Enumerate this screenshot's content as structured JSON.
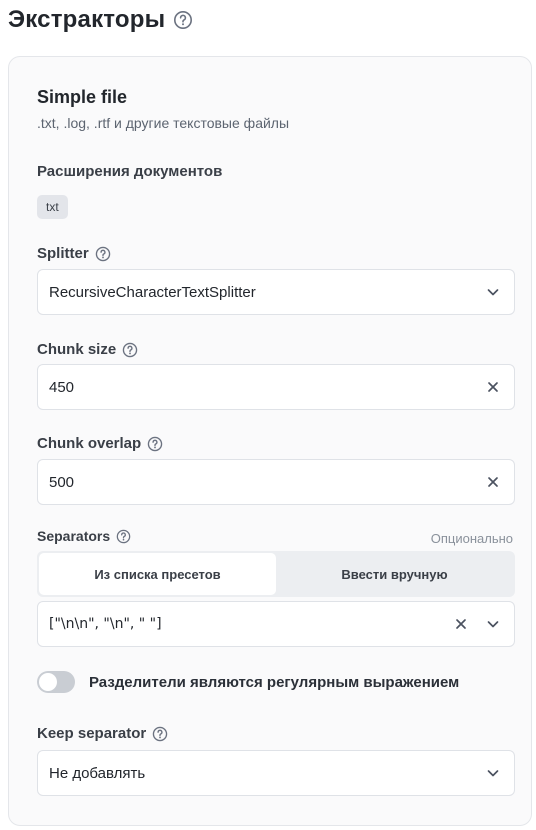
{
  "page": {
    "title": "Экстракторы"
  },
  "extractor": {
    "title": "Simple file",
    "subtitle": ".txt, .log, .rtf и другие текстовые файлы"
  },
  "doc_extensions": {
    "label": "Расширения документов",
    "tags": [
      "txt"
    ]
  },
  "splitter": {
    "label": "Splitter",
    "value": "RecursiveCharacterTextSplitter"
  },
  "chunk_size": {
    "label": "Chunk size",
    "value": "450"
  },
  "chunk_overlap": {
    "label": "Chunk overlap",
    "value": "500"
  },
  "separators": {
    "label": "Separators",
    "optional": "Опционально",
    "tabs": [
      "Из списка пресетов",
      "Ввести вручную"
    ],
    "active_tab": 0,
    "value": "[\"\\n\\n\", \"\\n\", \" \"]"
  },
  "regex_toggle": {
    "label": "Разделители являются регулярным выражением",
    "checked": false
  },
  "keep_separator": {
    "label": "Keep separator",
    "value": "Не добавлять"
  },
  "colors": {
    "title_text": "#22262c",
    "card_bg": "#fafafb",
    "border": "#dfe2e7",
    "toggle_off": "#c9cdd3",
    "segment_bg": "#eceef1"
  }
}
